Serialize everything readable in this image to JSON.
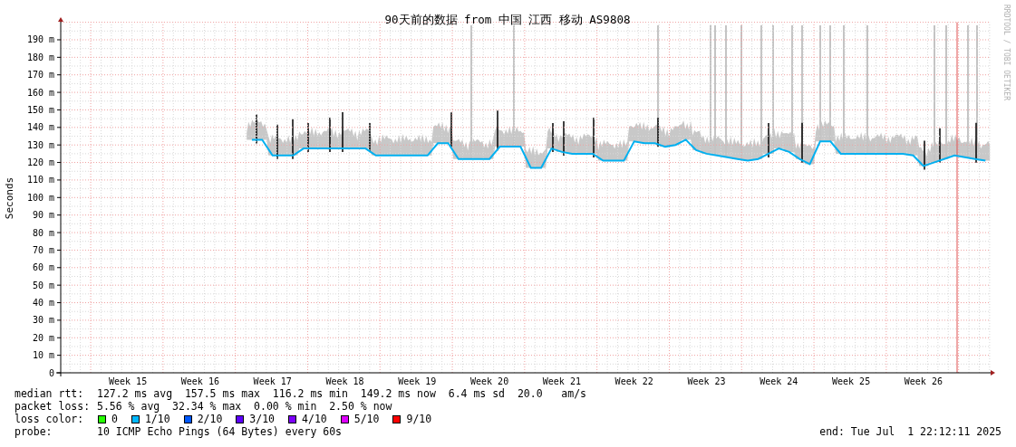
{
  "chart": {
    "credit": "RRDTOOL / TOBI OETIKER",
    "chart_data": {
      "type": "line",
      "title": "90天前的数据 from 中国 江西 移动 AS9808",
      "ylabel": "Seconds",
      "ylim": [
        0,
        200
      ],
      "grid": true,
      "categories": [
        null,
        null,
        null,
        null,
        null,
        null,
        "Week 15",
        null,
        null,
        null,
        null,
        null,
        null,
        "Week 16",
        null,
        null,
        null,
        null,
        null,
        null,
        "Week 17",
        null,
        null,
        null,
        null,
        null,
        null,
        "Week 18",
        null,
        null,
        null,
        null,
        null,
        null,
        "Week 19",
        null,
        null,
        null,
        null,
        null,
        null,
        "Week 20",
        null,
        null,
        null,
        null,
        null,
        null,
        "Week 21",
        null,
        null,
        null,
        null,
        null,
        null,
        "Week 22",
        null,
        null,
        null,
        null,
        null,
        null,
        "Week 23",
        null,
        null,
        null,
        null,
        null,
        null,
        "Week 24",
        null,
        null,
        null,
        null,
        null,
        null,
        "Week 25",
        null,
        null,
        null,
        null,
        null,
        null,
        "Week 26",
        null,
        null,
        null,
        null,
        null,
        null
      ],
      "yticks": [
        {
          "value": 0,
          "label": "0"
        },
        {
          "value": 10,
          "label": "10 m"
        },
        {
          "value": 20,
          "label": "20 m"
        },
        {
          "value": 30,
          "label": "30 m"
        },
        {
          "value": 40,
          "label": "40 m"
        },
        {
          "value": 50,
          "label": "50 m"
        },
        {
          "value": 60,
          "label": "60 m"
        },
        {
          "value": 70,
          "label": "70 m"
        },
        {
          "value": 80,
          "label": "80 m"
        },
        {
          "value": 90,
          "label": "90 m"
        },
        {
          "value": 100,
          "label": "100 m"
        },
        {
          "value": 110,
          "label": "110 m"
        },
        {
          "value": 120,
          "label": "120 m"
        },
        {
          "value": 130,
          "label": "130 m"
        },
        {
          "value": 140,
          "label": "140 m"
        },
        {
          "value": 150,
          "label": "150 m"
        },
        {
          "value": 160,
          "label": "160 m"
        },
        {
          "value": 170,
          "label": "170 m"
        },
        {
          "value": 180,
          "label": "180 m"
        },
        {
          "value": 190,
          "label": "190 m"
        }
      ],
      "series": [
        {
          "color": "#00b0f0",
          "values": [
            null,
            null,
            null,
            null,
            null,
            null,
            null,
            null,
            null,
            null,
            null,
            null,
            null,
            null,
            null,
            null,
            null,
            null,
            133,
            133,
            124,
            124,
            124,
            128,
            128,
            128,
            128,
            128,
            128,
            128,
            124,
            124,
            124,
            124,
            124,
            124,
            131,
            131,
            122,
            122,
            122,
            122,
            129,
            129,
            129,
            117,
            117,
            128,
            126,
            125,
            125,
            125,
            121,
            121,
            121,
            132,
            131,
            131,
            129,
            130,
            133,
            127,
            125,
            124,
            123,
            122,
            121,
            122,
            125,
            128,
            126,
            122,
            119,
            132,
            132,
            125,
            125,
            125,
            125,
            125,
            125,
            125,
            124,
            118,
            120,
            122,
            124,
            123,
            122,
            121
          ]
        }
      ]
    }
  },
  "legend": {
    "stats": [
      {
        "label": "median rtt:",
        "text": "127.2 ms avg  157.5 ms max  116.2 ms min  149.2 ms now  6.4 ms sd  20.0   am/s"
      },
      {
        "label": "packet loss:",
        "text": "5.56 % avg  32.34 % max  0.00 % min  2.50 % now"
      }
    ],
    "loss_label": "loss color:",
    "loss_colors": [
      {
        "label": "0",
        "color": "#26ff00"
      },
      {
        "label": "1/10",
        "color": "#00b8ff"
      },
      {
        "label": "2/10",
        "color": "#0059ff"
      },
      {
        "label": "3/10",
        "color": "#5e00ff"
      },
      {
        "label": "4/10",
        "color": "#7e00ff"
      },
      {
        "label": "5/10",
        "color": "#dd00ff"
      },
      {
        "label": "9/10",
        "color": "#ff0000"
      }
    ],
    "probe_label": "probe:",
    "probe": "10 ICMP Echo Pings (64 Bytes) every 60s",
    "end": "end: Tue Jul  1 22:12:11 2025"
  }
}
